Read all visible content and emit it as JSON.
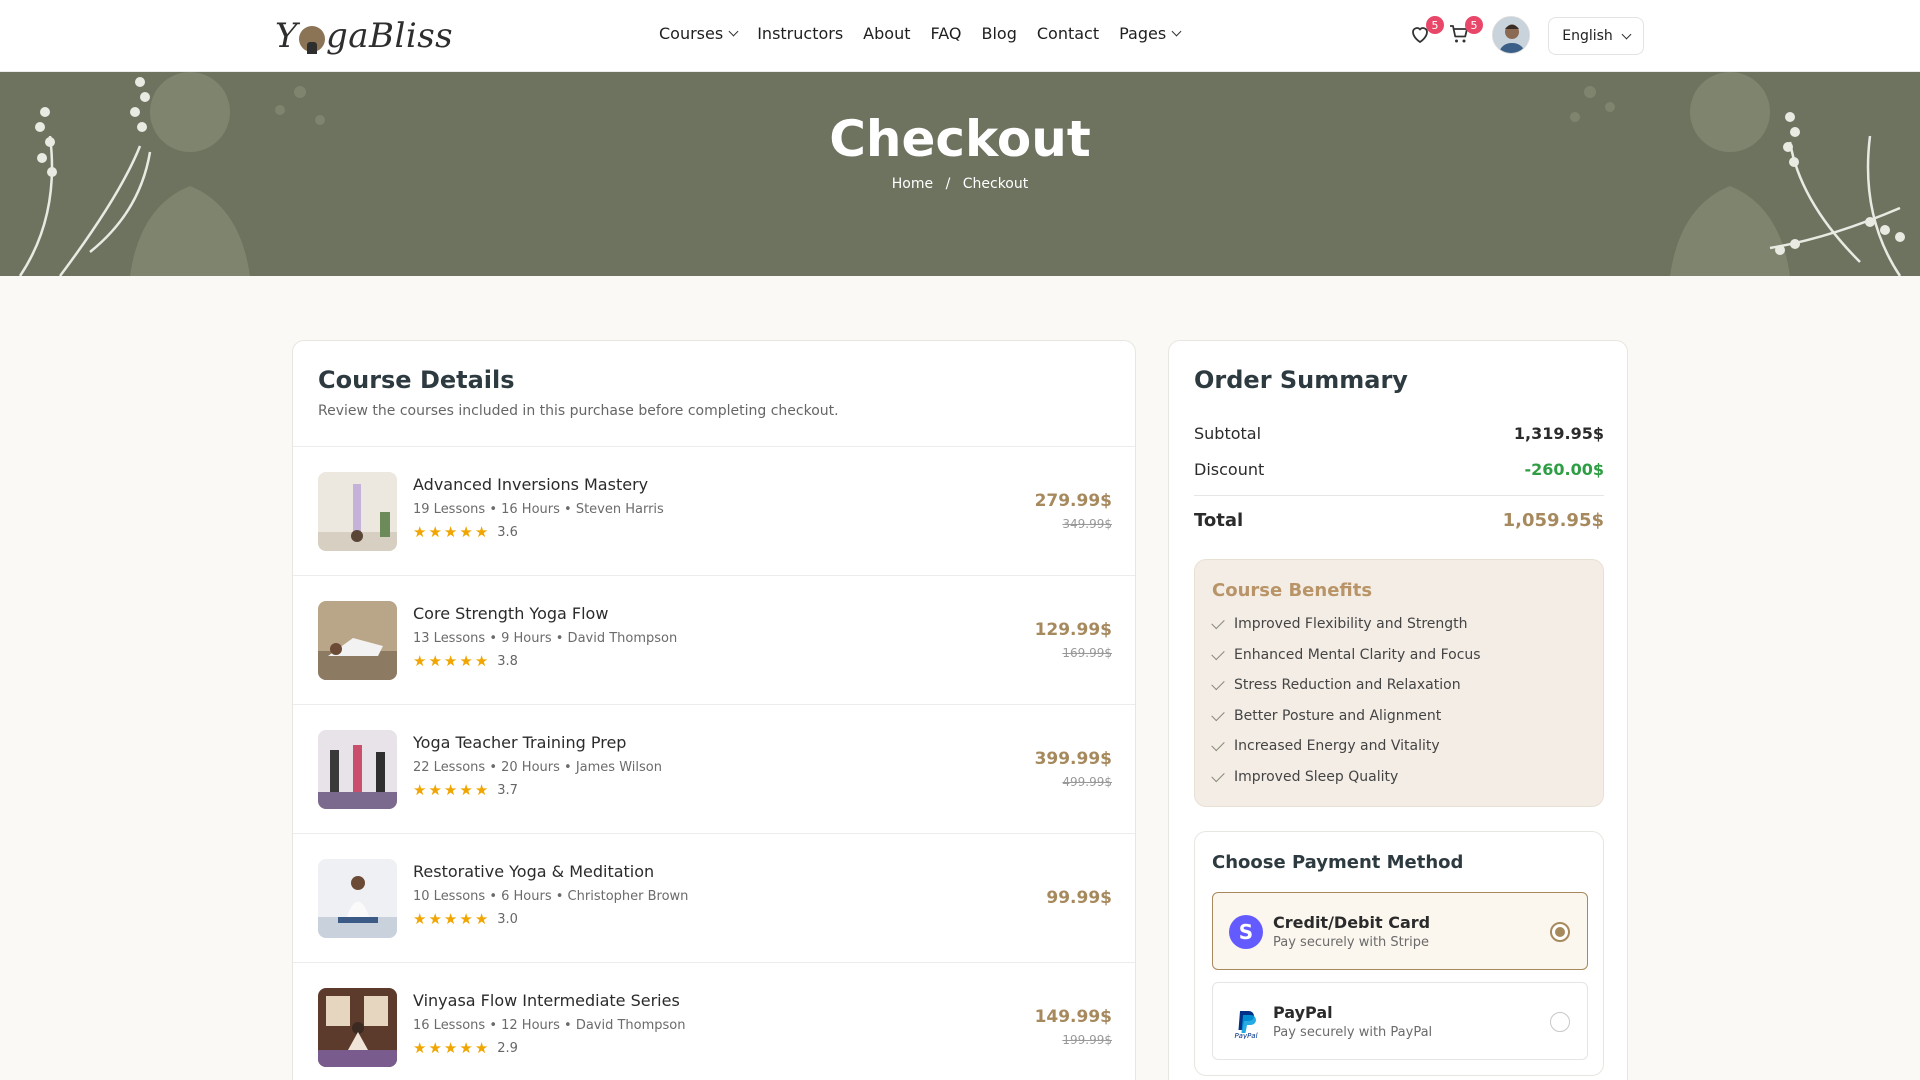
{
  "header": {
    "logo_text_left": "Y",
    "logo_text_right": "gaBliss",
    "nav": [
      {
        "label": "Courses",
        "dropdown": true
      },
      {
        "label": "Instructors",
        "dropdown": false
      },
      {
        "label": "About",
        "dropdown": false
      },
      {
        "label": "FAQ",
        "dropdown": false
      },
      {
        "label": "Blog",
        "dropdown": false
      },
      {
        "label": "Contact",
        "dropdown": false
      },
      {
        "label": "Pages",
        "dropdown": true
      }
    ],
    "wishlist_count": "5",
    "cart_count": "5",
    "language": "English"
  },
  "banner": {
    "title": "Checkout",
    "breadcrumb_home": "Home",
    "breadcrumb_sep": "/",
    "breadcrumb_current": "Checkout"
  },
  "course_details": {
    "title": "Course Details",
    "subtitle": "Review the courses included in this purchase before completing checkout.",
    "courses": [
      {
        "name": "Advanced Inversions Mastery",
        "meta": "19 Lessons • 16 Hours • Steven Harris",
        "rating": "3.6",
        "price": "279.99$",
        "old_price": "349.99$"
      },
      {
        "name": "Core Strength Yoga Flow",
        "meta": "13 Lessons • 9 Hours • David Thompson",
        "rating": "3.8",
        "price": "129.99$",
        "old_price": "169.99$"
      },
      {
        "name": "Yoga Teacher Training Prep",
        "meta": "22 Lessons • 20 Hours • James Wilson",
        "rating": "3.7",
        "price": "399.99$",
        "old_price": "499.99$"
      },
      {
        "name": "Restorative Yoga & Meditation",
        "meta": "10 Lessons • 6 Hours • Christopher Brown",
        "rating": "3.0",
        "price": "99.99$",
        "old_price": ""
      },
      {
        "name": "Vinyasa Flow Intermediate Series",
        "meta": "16 Lessons • 12 Hours • David Thompson",
        "rating": "2.9",
        "price": "149.99$",
        "old_price": "199.99$"
      }
    ]
  },
  "summary": {
    "title": "Order Summary",
    "subtotal_label": "Subtotal",
    "subtotal_value": "1,319.95$",
    "discount_label": "Discount",
    "discount_value": "-260.00$",
    "total_label": "Total",
    "total_value": "1,059.95$"
  },
  "benefits": {
    "title": "Course Benefits",
    "items": [
      "Improved Flexibility and Strength",
      "Enhanced Mental Clarity and Focus",
      "Stress Reduction and Relaxation",
      "Better Posture and Alignment",
      "Increased Energy and Vitality",
      "Improved Sleep Quality"
    ]
  },
  "payment": {
    "title": "Choose Payment Method",
    "options": [
      {
        "name": "Credit/Debit Card",
        "desc": "Pay securely with Stripe",
        "icon": "stripe-icon",
        "selected": true
      },
      {
        "name": "PayPal",
        "desc": "Pay securely with PayPal",
        "icon": "paypal-icon",
        "selected": false
      }
    ]
  },
  "colors": {
    "accent": "#a7895e",
    "banner": "#6d735f",
    "discount": "#2e9e44",
    "badge": "#e8476a",
    "star": "#f0a500"
  }
}
